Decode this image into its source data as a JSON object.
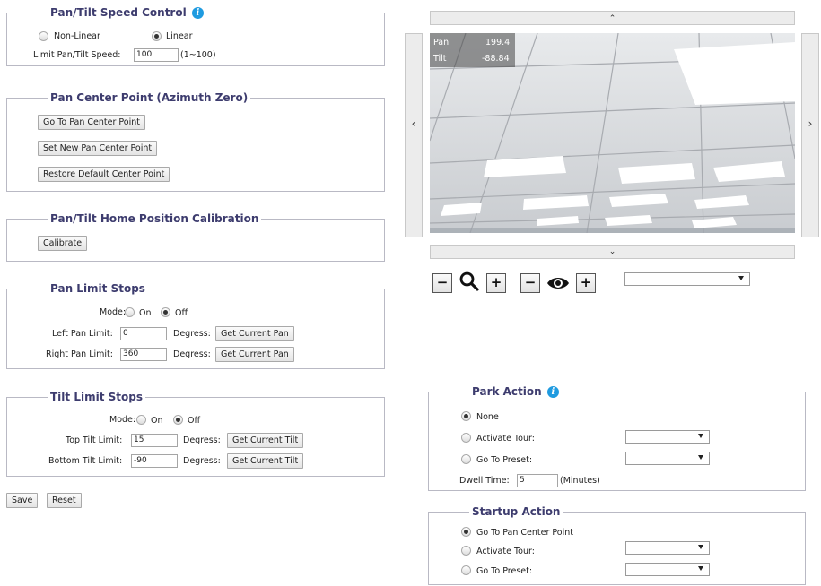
{
  "pan_tilt_speed": {
    "legend": "Pan/Tilt Speed Control",
    "option_nonlinear": "Non-Linear",
    "option_linear": "Linear",
    "selected": "Linear",
    "limit_label": "Limit Pan/Tilt Speed:",
    "limit_value": "100",
    "limit_range": "(1~100)"
  },
  "pan_center": {
    "legend": "Pan Center Point (Azimuth Zero)",
    "go_to": "Go To Pan Center Point",
    "set_new": "Set New Pan Center Point",
    "restore": "Restore Default Center Point"
  },
  "home_calibration": {
    "legend": "Pan/Tilt Home Position Calibration",
    "calibrate": "Calibrate"
  },
  "pan_limit": {
    "legend": "Pan Limit Stops",
    "mode_label": "Mode:",
    "on": "On",
    "off": "Off",
    "selected": "Off",
    "left_label": "Left Pan Limit:",
    "left_value": "0",
    "right_label": "Right Pan Limit:",
    "right_value": "360",
    "degress": "Degress:",
    "get_current": "Get Current Pan"
  },
  "tilt_limit": {
    "legend": "Tilt Limit Stops",
    "mode_label": "Mode:",
    "on": "On",
    "off": "Off",
    "selected": "Off",
    "top_label": "Top Tilt Limit:",
    "top_value": "15",
    "bottom_label": "Bottom Tilt Limit:",
    "bottom_value": "-90",
    "degress": "Degress:",
    "get_current": "Get Current Tilt"
  },
  "footer": {
    "save": "Save",
    "reset": "Reset"
  },
  "camera": {
    "pan_label": "Pan",
    "pan_value": "199.4",
    "tilt_label": "Tilt",
    "tilt_value": "-88.84",
    "up_arrow": "⌃",
    "down_arrow": "⌄",
    "left_arrow": "‹",
    "right_arrow": "›"
  },
  "controls": {
    "minus": "−",
    "plus": "+",
    "preset_selected": ""
  },
  "park_action": {
    "legend": "Park Action",
    "none": "None",
    "activate_tour": "Activate Tour:",
    "go_to_preset": "Go To Preset:",
    "selected": "None",
    "dwell_label": "Dwell Time:",
    "dwell_value": "5",
    "dwell_unit": "(Minutes)"
  },
  "startup_action": {
    "legend": "Startup Action",
    "go_to_center": "Go To Pan Center Point",
    "activate_tour": "Activate Tour:",
    "go_to_preset": "Go To Preset:",
    "selected": "Go To Pan Center Point"
  },
  "colors": {
    "legend_text": "#3d3c6e",
    "info_icon": "#1f9be0",
    "border": "#b9b9c4"
  }
}
